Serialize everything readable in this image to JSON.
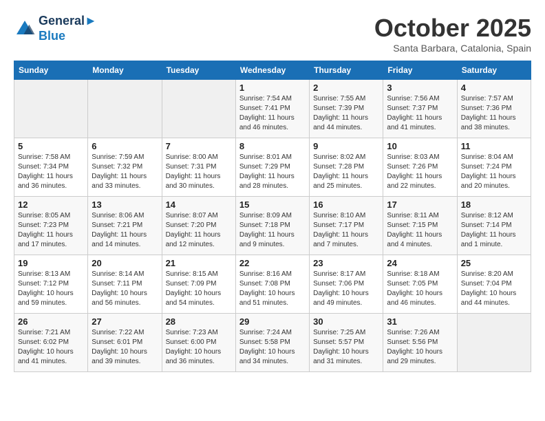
{
  "header": {
    "logo_line1": "General",
    "logo_line2": "Blue",
    "month": "October 2025",
    "location": "Santa Barbara, Catalonia, Spain"
  },
  "days_of_week": [
    "Sunday",
    "Monday",
    "Tuesday",
    "Wednesday",
    "Thursday",
    "Friday",
    "Saturday"
  ],
  "weeks": [
    [
      {
        "day": "",
        "info": ""
      },
      {
        "day": "",
        "info": ""
      },
      {
        "day": "",
        "info": ""
      },
      {
        "day": "1",
        "info": "Sunrise: 7:54 AM\nSunset: 7:41 PM\nDaylight: 11 hours and 46 minutes."
      },
      {
        "day": "2",
        "info": "Sunrise: 7:55 AM\nSunset: 7:39 PM\nDaylight: 11 hours and 44 minutes."
      },
      {
        "day": "3",
        "info": "Sunrise: 7:56 AM\nSunset: 7:37 PM\nDaylight: 11 hours and 41 minutes."
      },
      {
        "day": "4",
        "info": "Sunrise: 7:57 AM\nSunset: 7:36 PM\nDaylight: 11 hours and 38 minutes."
      }
    ],
    [
      {
        "day": "5",
        "info": "Sunrise: 7:58 AM\nSunset: 7:34 PM\nDaylight: 11 hours and 36 minutes."
      },
      {
        "day": "6",
        "info": "Sunrise: 7:59 AM\nSunset: 7:32 PM\nDaylight: 11 hours and 33 minutes."
      },
      {
        "day": "7",
        "info": "Sunrise: 8:00 AM\nSunset: 7:31 PM\nDaylight: 11 hours and 30 minutes."
      },
      {
        "day": "8",
        "info": "Sunrise: 8:01 AM\nSunset: 7:29 PM\nDaylight: 11 hours and 28 minutes."
      },
      {
        "day": "9",
        "info": "Sunrise: 8:02 AM\nSunset: 7:28 PM\nDaylight: 11 hours and 25 minutes."
      },
      {
        "day": "10",
        "info": "Sunrise: 8:03 AM\nSunset: 7:26 PM\nDaylight: 11 hours and 22 minutes."
      },
      {
        "day": "11",
        "info": "Sunrise: 8:04 AM\nSunset: 7:24 PM\nDaylight: 11 hours and 20 minutes."
      }
    ],
    [
      {
        "day": "12",
        "info": "Sunrise: 8:05 AM\nSunset: 7:23 PM\nDaylight: 11 hours and 17 minutes."
      },
      {
        "day": "13",
        "info": "Sunrise: 8:06 AM\nSunset: 7:21 PM\nDaylight: 11 hours and 14 minutes."
      },
      {
        "day": "14",
        "info": "Sunrise: 8:07 AM\nSunset: 7:20 PM\nDaylight: 11 hours and 12 minutes."
      },
      {
        "day": "15",
        "info": "Sunrise: 8:09 AM\nSunset: 7:18 PM\nDaylight: 11 hours and 9 minutes."
      },
      {
        "day": "16",
        "info": "Sunrise: 8:10 AM\nSunset: 7:17 PM\nDaylight: 11 hours and 7 minutes."
      },
      {
        "day": "17",
        "info": "Sunrise: 8:11 AM\nSunset: 7:15 PM\nDaylight: 11 hours and 4 minutes."
      },
      {
        "day": "18",
        "info": "Sunrise: 8:12 AM\nSunset: 7:14 PM\nDaylight: 11 hours and 1 minute."
      }
    ],
    [
      {
        "day": "19",
        "info": "Sunrise: 8:13 AM\nSunset: 7:12 PM\nDaylight: 10 hours and 59 minutes."
      },
      {
        "day": "20",
        "info": "Sunrise: 8:14 AM\nSunset: 7:11 PM\nDaylight: 10 hours and 56 minutes."
      },
      {
        "day": "21",
        "info": "Sunrise: 8:15 AM\nSunset: 7:09 PM\nDaylight: 10 hours and 54 minutes."
      },
      {
        "day": "22",
        "info": "Sunrise: 8:16 AM\nSunset: 7:08 PM\nDaylight: 10 hours and 51 minutes."
      },
      {
        "day": "23",
        "info": "Sunrise: 8:17 AM\nSunset: 7:06 PM\nDaylight: 10 hours and 49 minutes."
      },
      {
        "day": "24",
        "info": "Sunrise: 8:18 AM\nSunset: 7:05 PM\nDaylight: 10 hours and 46 minutes."
      },
      {
        "day": "25",
        "info": "Sunrise: 8:20 AM\nSunset: 7:04 PM\nDaylight: 10 hours and 44 minutes."
      }
    ],
    [
      {
        "day": "26",
        "info": "Sunrise: 7:21 AM\nSunset: 6:02 PM\nDaylight: 10 hours and 41 minutes."
      },
      {
        "day": "27",
        "info": "Sunrise: 7:22 AM\nSunset: 6:01 PM\nDaylight: 10 hours and 39 minutes."
      },
      {
        "day": "28",
        "info": "Sunrise: 7:23 AM\nSunset: 6:00 PM\nDaylight: 10 hours and 36 minutes."
      },
      {
        "day": "29",
        "info": "Sunrise: 7:24 AM\nSunset: 5:58 PM\nDaylight: 10 hours and 34 minutes."
      },
      {
        "day": "30",
        "info": "Sunrise: 7:25 AM\nSunset: 5:57 PM\nDaylight: 10 hours and 31 minutes."
      },
      {
        "day": "31",
        "info": "Sunrise: 7:26 AM\nSunset: 5:56 PM\nDaylight: 10 hours and 29 minutes."
      },
      {
        "day": "",
        "info": ""
      }
    ]
  ]
}
